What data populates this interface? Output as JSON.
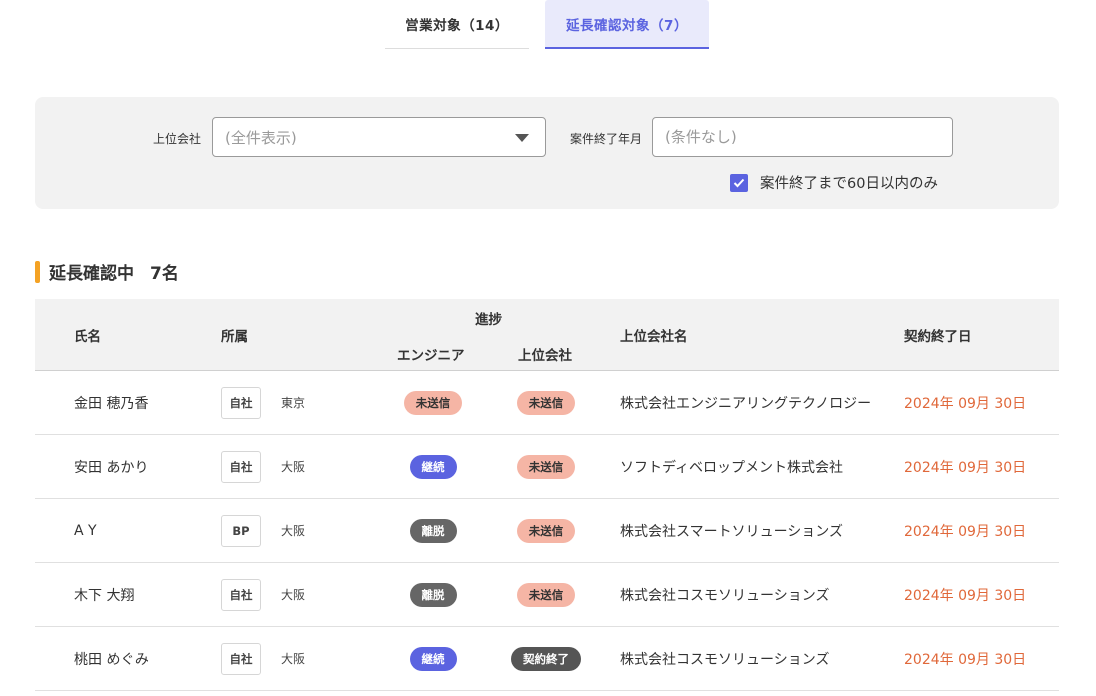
{
  "tabs": [
    {
      "label": "営業対象（14）",
      "active": false
    },
    {
      "label": "延長確認対象（7）",
      "active": true
    }
  ],
  "filter": {
    "upper_company_label": "上位会社",
    "upper_company_value": "(全件表示)",
    "end_month_label": "案件終了年月",
    "end_month_placeholder": "(条件なし)",
    "within60_label": "案件終了まで60日以内のみ",
    "within60_checked": true
  },
  "section": {
    "title": "延長確認中",
    "count": "7名"
  },
  "table": {
    "headers": {
      "name": "氏名",
      "affiliation": "所属",
      "progress": "進捗",
      "progress_engineer": "エンジニア",
      "progress_upper": "上位会社",
      "upper_company": "上位会社名",
      "contract_end": "契約終了日"
    },
    "rows": [
      {
        "name": "金田 穂乃香",
        "type": "自社",
        "location": "東京",
        "engineer_status": "未送信",
        "engineer_kind": "unsent",
        "upper_status": "未送信",
        "upper_kind": "unsent",
        "company": "株式会社エンジニアリングテクノロジー",
        "end_date": "2024年 09月 30日"
      },
      {
        "name": "安田 あかり",
        "type": "自社",
        "location": "大阪",
        "engineer_status": "継続",
        "engineer_kind": "continue",
        "upper_status": "未送信",
        "upper_kind": "unsent",
        "company": "ソフトディベロップメント株式会社",
        "end_date": "2024年 09月 30日"
      },
      {
        "name": "A Y",
        "type": "BP",
        "location": "大阪",
        "engineer_status": "離脱",
        "engineer_kind": "leave",
        "upper_status": "未送信",
        "upper_kind": "unsent",
        "company": "株式会社スマートソリューションズ",
        "end_date": "2024年 09月 30日"
      },
      {
        "name": "木下 大翔",
        "type": "自社",
        "location": "大阪",
        "engineer_status": "離脱",
        "engineer_kind": "leave",
        "upper_status": "未送信",
        "upper_kind": "unsent",
        "company": "株式会社コスモソリューションズ",
        "end_date": "2024年 09月 30日"
      },
      {
        "name": "桃田 めぐみ",
        "type": "自社",
        "location": "大阪",
        "engineer_status": "継続",
        "engineer_kind": "continue",
        "upper_status": "契約終了",
        "upper_kind": "ended",
        "company": "株式会社コスモソリューションズ",
        "end_date": "2024年 09月 30日"
      }
    ]
  },
  "colors": {
    "accent": "#5b63e0",
    "section_bar": "#f4a224",
    "date_text": "#e0683a",
    "unsent_pill": "#f5b5a5"
  }
}
